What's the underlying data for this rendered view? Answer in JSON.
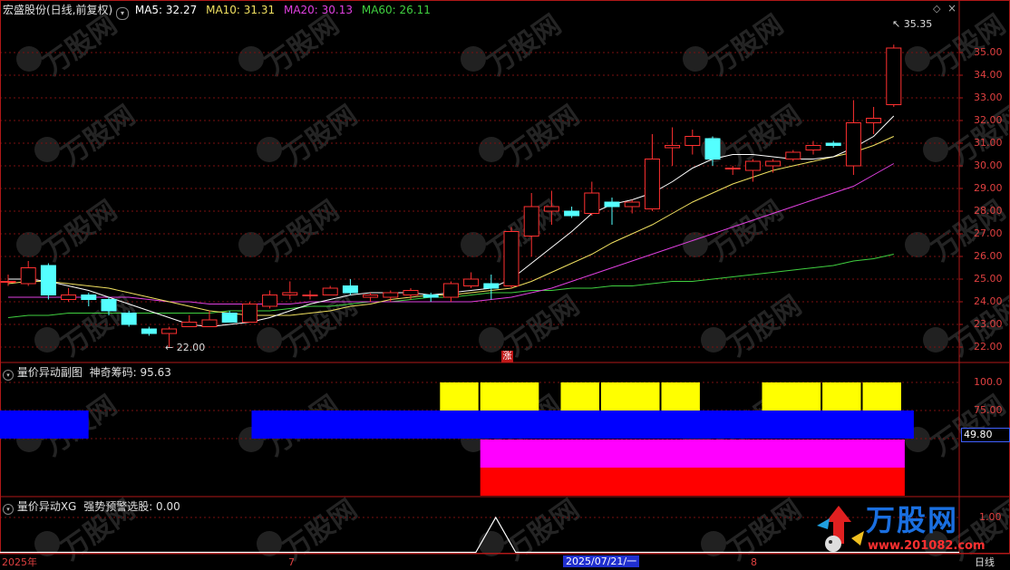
{
  "main_header": {
    "stock_title": "宏盛股份(日线,前复权)",
    "ma5": "MA5: 32.27",
    "ma10": "MA10: 31.31",
    "ma20": "MA20: 30.13",
    "ma60": "MA60: 26.11",
    "colors": {
      "ma5": "#ffffff",
      "ma10": "#f0e060",
      "ma20": "#e040e0",
      "ma60": "#40d040"
    }
  },
  "sub1_header": {
    "title": "量价异动副图",
    "value": "神奇筹码: 95.63"
  },
  "sub2_header": {
    "title": "量价异动XG",
    "value": "强势预警选股: 0.00"
  },
  "labels": {
    "high_marker": "35.35",
    "low_marker": "22.00",
    "zhang_badge": "涨",
    "sub1_readout": "49.80",
    "period": "日线"
  },
  "price_axis": [
    "35.00",
    "34.00",
    "33.00",
    "32.00",
    "31.00",
    "30.00",
    "29.00",
    "28.00",
    "27.00",
    "26.00",
    "25.00",
    "24.00",
    "23.00",
    "22.00"
  ],
  "sub1_axis": [
    "100.0",
    "75.00",
    "50.00"
  ],
  "sub2_axis": [
    "1.00"
  ],
  "date_axis": [
    "2025年",
    "7",
    "2025/07/21/一",
    "8"
  ],
  "watermark": {
    "brand": "万股网",
    "url": "www.201082.com"
  },
  "chart_data": {
    "type": "candlestick",
    "ylim": [
      21.5,
      35.8
    ],
    "candles": [
      {
        "o": 24.9,
        "h": 25.2,
        "l": 24.7,
        "c": 24.9
      },
      {
        "o": 24.8,
        "h": 25.8,
        "l": 24.7,
        "c": 25.5
      },
      {
        "o": 25.6,
        "h": 25.7,
        "l": 24.1,
        "c": 24.3
      },
      {
        "o": 24.1,
        "h": 24.6,
        "l": 24.0,
        "c": 24.3
      },
      {
        "o": 24.3,
        "h": 24.4,
        "l": 23.8,
        "c": 24.1
      },
      {
        "o": 24.1,
        "h": 24.2,
        "l": 23.4,
        "c": 23.6
      },
      {
        "o": 23.5,
        "h": 23.6,
        "l": 22.9,
        "c": 23.0
      },
      {
        "o": 22.8,
        "h": 22.9,
        "l": 22.5,
        "c": 22.6
      },
      {
        "o": 22.6,
        "h": 22.9,
        "l": 22.0,
        "c": 22.8
      },
      {
        "o": 22.9,
        "h": 23.4,
        "l": 22.9,
        "c": 23.1
      },
      {
        "o": 22.9,
        "h": 23.6,
        "l": 22.9,
        "c": 23.2
      },
      {
        "o": 23.5,
        "h": 23.6,
        "l": 23.1,
        "c": 23.1
      },
      {
        "o": 23.1,
        "h": 24.0,
        "l": 23.1,
        "c": 23.9
      },
      {
        "o": 23.8,
        "h": 24.5,
        "l": 23.7,
        "c": 24.3
      },
      {
        "o": 24.3,
        "h": 24.9,
        "l": 24.1,
        "c": 24.4
      },
      {
        "o": 24.3,
        "h": 24.5,
        "l": 24.1,
        "c": 24.3
      },
      {
        "o": 24.3,
        "h": 24.7,
        "l": 24.3,
        "c": 24.6
      },
      {
        "o": 24.7,
        "h": 25.0,
        "l": 24.3,
        "c": 24.4
      },
      {
        "o": 24.2,
        "h": 24.4,
        "l": 24.0,
        "c": 24.3
      },
      {
        "o": 24.2,
        "h": 24.5,
        "l": 24.0,
        "c": 24.4
      },
      {
        "o": 24.3,
        "h": 24.6,
        "l": 24.1,
        "c": 24.5
      },
      {
        "o": 24.3,
        "h": 24.4,
        "l": 24.0,
        "c": 24.2
      },
      {
        "o": 24.2,
        "h": 24.9,
        "l": 24.0,
        "c": 24.8
      },
      {
        "o": 24.7,
        "h": 25.3,
        "l": 24.6,
        "c": 25.0
      },
      {
        "o": 24.8,
        "h": 25.2,
        "l": 24.1,
        "c": 24.6
      },
      {
        "o": 24.7,
        "h": 27.3,
        "l": 24.6,
        "c": 27.1
      },
      {
        "o": 26.9,
        "h": 28.8,
        "l": 26.0,
        "c": 28.2
      },
      {
        "o": 28.0,
        "h": 28.9,
        "l": 27.4,
        "c": 28.2
      },
      {
        "o": 28.0,
        "h": 28.2,
        "l": 27.7,
        "c": 27.8
      },
      {
        "o": 27.9,
        "h": 29.3,
        "l": 27.8,
        "c": 28.8
      },
      {
        "o": 28.4,
        "h": 28.6,
        "l": 27.4,
        "c": 28.2
      },
      {
        "o": 28.2,
        "h": 28.5,
        "l": 27.9,
        "c": 28.4
      },
      {
        "o": 28.1,
        "h": 31.4,
        "l": 28.0,
        "c": 30.3
      },
      {
        "o": 30.8,
        "h": 31.7,
        "l": 30.0,
        "c": 30.9
      },
      {
        "o": 30.9,
        "h": 31.6,
        "l": 30.5,
        "c": 31.3
      },
      {
        "o": 31.2,
        "h": 31.3,
        "l": 30.0,
        "c": 30.3
      },
      {
        "o": 29.9,
        "h": 30.0,
        "l": 29.6,
        "c": 29.9
      },
      {
        "o": 29.8,
        "h": 30.3,
        "l": 29.3,
        "c": 30.2
      },
      {
        "o": 30.0,
        "h": 30.3,
        "l": 29.7,
        "c": 30.2
      },
      {
        "o": 30.3,
        "h": 30.7,
        "l": 30.2,
        "c": 30.6
      },
      {
        "o": 30.7,
        "h": 31.1,
        "l": 30.5,
        "c": 30.9
      },
      {
        "o": 31.0,
        "h": 31.1,
        "l": 30.8,
        "c": 30.9
      },
      {
        "o": 30.0,
        "h": 32.9,
        "l": 29.6,
        "c": 31.9
      },
      {
        "o": 31.9,
        "h": 32.6,
        "l": 31.4,
        "c": 32.1
      },
      {
        "o": 32.7,
        "h": 35.35,
        "l": 32.6,
        "c": 35.2
      }
    ],
    "ma5": [
      25.0,
      25.0,
      24.9,
      24.7,
      24.5,
      24.2,
      23.9,
      23.6,
      23.3,
      23.0,
      22.9,
      23.0,
      23.1,
      23.3,
      23.6,
      23.9,
      24.1,
      24.3,
      24.4,
      24.4,
      24.4,
      24.3,
      24.4,
      24.5,
      24.6,
      25.0,
      25.7,
      26.4,
      27.1,
      27.9,
      28.3,
      28.5,
      28.8,
      29.3,
      29.9,
      30.3,
      30.5,
      30.5,
      30.4,
      30.3,
      30.3,
      30.4,
      30.8,
      31.3,
      32.2
    ],
    "ma10": [
      24.8,
      24.9,
      24.9,
      24.8,
      24.7,
      24.6,
      24.4,
      24.2,
      24.0,
      23.8,
      23.6,
      23.5,
      23.4,
      23.4,
      23.4,
      23.5,
      23.6,
      23.8,
      23.9,
      24.1,
      24.2,
      24.3,
      24.3,
      24.4,
      24.5,
      24.6,
      24.9,
      25.3,
      25.7,
      26.1,
      26.6,
      27.0,
      27.4,
      27.9,
      28.4,
      28.8,
      29.2,
      29.5,
      29.8,
      30.0,
      30.2,
      30.4,
      30.6,
      30.9,
      31.3
    ],
    "ma20": [
      24.2,
      24.2,
      24.2,
      24.2,
      24.2,
      24.2,
      24.2,
      24.1,
      24.0,
      24.0,
      23.9,
      23.9,
      23.9,
      23.9,
      23.9,
      24.0,
      24.0,
      24.0,
      24.0,
      24.0,
      24.0,
      24.0,
      24.0,
      24.0,
      24.1,
      24.2,
      24.4,
      24.6,
      24.9,
      25.2,
      25.5,
      25.8,
      26.1,
      26.4,
      26.7,
      27.0,
      27.3,
      27.6,
      27.9,
      28.2,
      28.5,
      28.8,
      29.1,
      29.6,
      30.1
    ],
    "ma60": [
      23.3,
      23.4,
      23.4,
      23.5,
      23.5,
      23.5,
      23.5,
      23.5,
      23.5,
      23.5,
      23.5,
      23.6,
      23.6,
      23.6,
      23.7,
      23.8,
      23.8,
      23.9,
      24.0,
      24.0,
      24.1,
      24.2,
      24.2,
      24.3,
      24.4,
      24.4,
      24.5,
      24.5,
      24.6,
      24.6,
      24.7,
      24.7,
      24.8,
      24.9,
      24.9,
      25.0,
      25.1,
      25.2,
      25.3,
      25.4,
      25.5,
      25.6,
      25.8,
      25.9,
      26.1
    ],
    "sub1": {
      "ylim": [
        25,
        100
      ],
      "yellow_ranges": [
        [
          22,
          23
        ],
        [
          24,
          26
        ],
        [
          28,
          29
        ],
        [
          30,
          32
        ],
        [
          33,
          34
        ],
        [
          38,
          40
        ],
        [
          41,
          42
        ],
        [
          43,
          44
        ]
      ],
      "blue_ranges": [
        [
          0,
          3
        ],
        [
          13,
          44
        ]
      ],
      "magenta_range": [
        24,
        44
      ],
      "red_range": [
        24,
        44
      ],
      "readout": 49.8
    },
    "sub2": {
      "spike_index": 24,
      "value": 0.0
    }
  }
}
